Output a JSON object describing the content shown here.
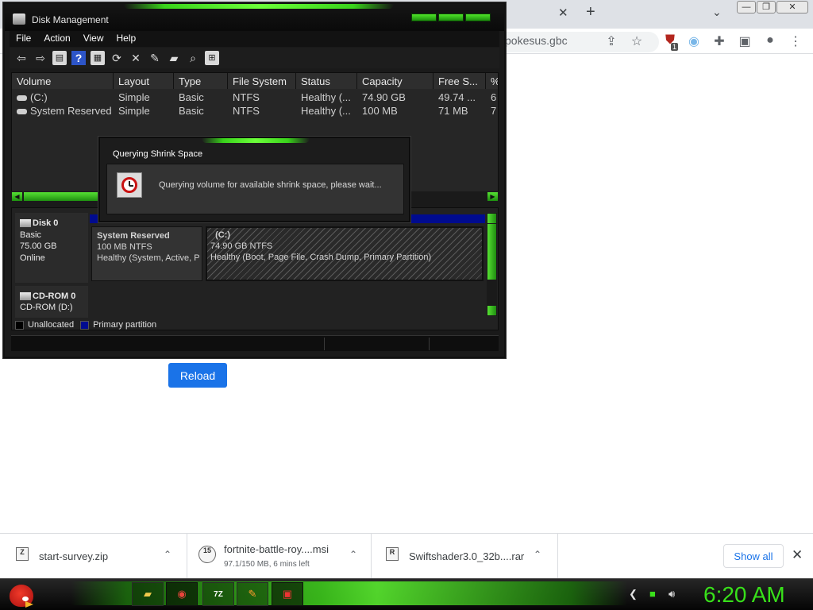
{
  "browser": {
    "url": "pokesus.gbc",
    "tab_close": "✕",
    "new_tab": "+",
    "reload_label": "Reload",
    "window_buttons": [
      "—",
      "❐",
      "✕"
    ],
    "extension_badge": "1"
  },
  "disk_management": {
    "title": "Disk Management",
    "menu": [
      "File",
      "Action",
      "View",
      "Help"
    ],
    "columns": [
      "Volume",
      "Layout",
      "Type",
      "File System",
      "Status",
      "Capacity",
      "Free S...",
      "%"
    ],
    "rows": [
      {
        "volume": "(C:)",
        "layout": "Simple",
        "type": "Basic",
        "fs": "NTFS",
        "status": "Healthy (...",
        "capacity": "74.90 GB",
        "free": "49.74 ...",
        "pct": "6"
      },
      {
        "volume": "System Reserved",
        "layout": "Simple",
        "type": "Basic",
        "fs": "NTFS",
        "status": "Healthy (...",
        "capacity": "100 MB",
        "free": "71 MB",
        "pct": "7"
      }
    ],
    "disk0": {
      "name": "Disk 0",
      "type": "Basic",
      "size": "75.00 GB",
      "state": "Online"
    },
    "sys_reserved": {
      "name": "System Reserved",
      "size": "100 MB NTFS",
      "status": "Healthy (System, Active, P"
    },
    "c_part": {
      "name": "(C:)",
      "size": "74.90 GB NTFS",
      "status": "Healthy (Boot, Page File, Crash Dump, Primary Partition)"
    },
    "cdrom": {
      "name": "CD-ROM 0",
      "drive": "CD-ROM (D:)"
    },
    "legend": {
      "unallocated": "Unallocated",
      "primary": "Primary partition",
      "unallocated_color": "#000000",
      "primary_color": "#000b8f"
    }
  },
  "dialog": {
    "title": "Querying Shrink Space",
    "message": "Querying volume for available shrink space, please wait..."
  },
  "downloads": {
    "items": [
      {
        "name": "start-survey.zip",
        "sub": ""
      },
      {
        "name": "fortnite-battle-roy....msi",
        "sub": "97.1/150 MB, 6 mins left"
      },
      {
        "name": "Swiftshader3.0_32b....rar",
        "sub": ""
      }
    ],
    "show_all": "Show all",
    "close": "✕"
  },
  "taskbar": {
    "clock": "6:20 AM",
    "accent_color": "#38e01a"
  }
}
